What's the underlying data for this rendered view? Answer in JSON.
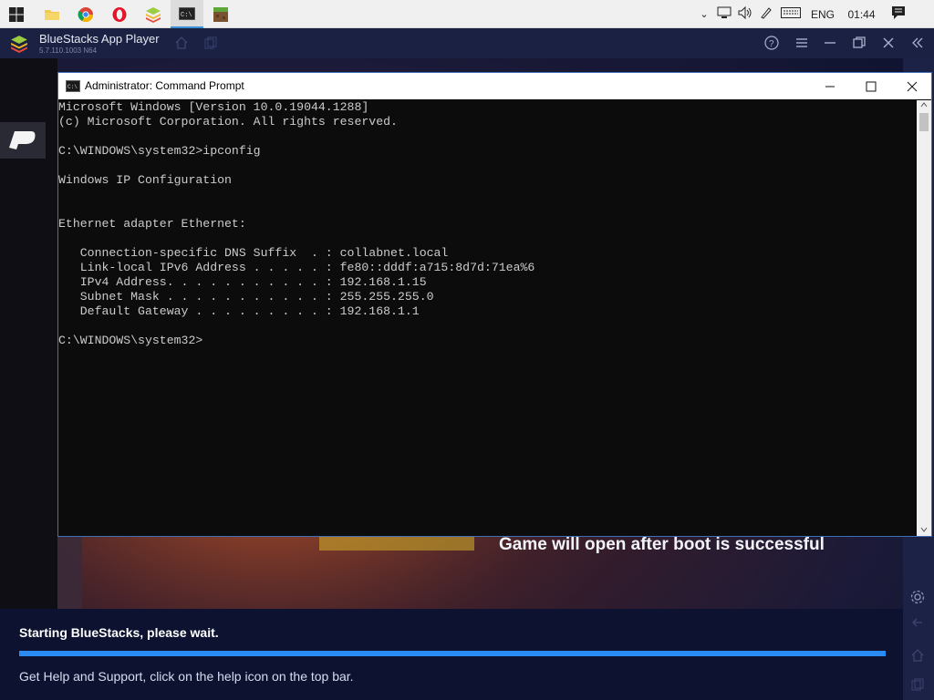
{
  "taskbar": {
    "apps": [
      "windows-start",
      "file-explorer",
      "chrome",
      "opera",
      "bluestacks",
      "command-prompt",
      "minecraft"
    ],
    "language": "ENG",
    "clock": "01:44"
  },
  "bluestacks": {
    "title": "BlueStacks App Player",
    "version": "5.7.110.1003 N64",
    "game_message": "Game will open after boot is successful",
    "starting_text": "Starting BlueStacks, please wait.",
    "progress": 1.0,
    "help_text": "Get Help and Support, click on the help icon on the top bar."
  },
  "cmd": {
    "title": "Administrator: Command Prompt",
    "lines": [
      "Microsoft Windows [Version 10.0.19044.1288]",
      "(c) Microsoft Corporation. All rights reserved.",
      "",
      "C:\\WINDOWS\\system32>ipconfig",
      "",
      "Windows IP Configuration",
      "",
      "",
      "Ethernet adapter Ethernet:",
      "",
      "   Connection-specific DNS Suffix  . : collabnet.local",
      "   Link-local IPv6 Address . . . . . : fe80::dddf:a715:8d7d:71ea%6",
      "   IPv4 Address. . . . . . . . . . . : 192.168.1.15",
      "   Subnet Mask . . . . . . . . . . . : 255.255.255.0",
      "   Default Gateway . . . . . . . . . : 192.168.1.1",
      "",
      "C:\\WINDOWS\\system32>"
    ]
  },
  "colors": {
    "accent": "#2a8bf2",
    "cmd_bg": "#0c0c0c",
    "cmd_text": "#cccccc"
  }
}
